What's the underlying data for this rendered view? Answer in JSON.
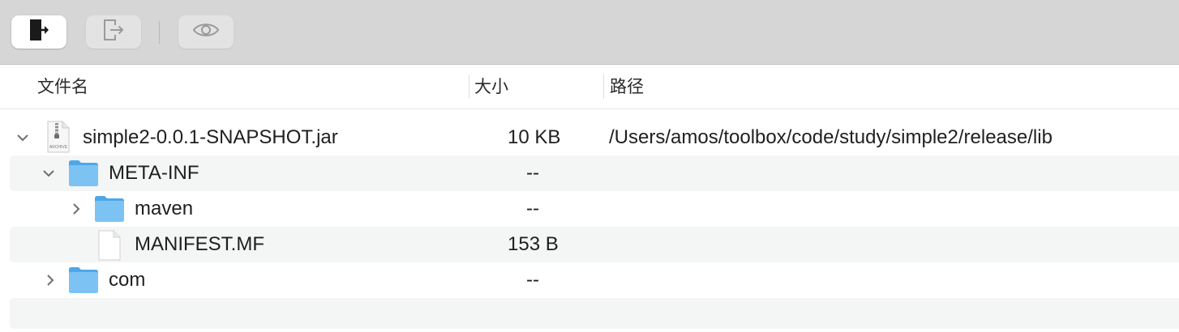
{
  "toolbar": {
    "buttons": [
      {
        "name": "export-button",
        "icon": "exit-door-icon",
        "state": "active"
      },
      {
        "name": "extract-button",
        "icon": "exit-door-outline-icon",
        "state": "disabled"
      },
      {
        "name": "preview-button",
        "icon": "eye-icon",
        "state": "disabled"
      }
    ]
  },
  "columns": {
    "name": "文件名",
    "size": "大小",
    "path": "路径"
  },
  "rows": [
    {
      "name": "simple2-0.0.1-SNAPSHOT.jar",
      "size": "10 KB",
      "path": "/Users/amos/toolbox/code/study/simple2/release/lib",
      "kind": "archive",
      "expanded": true,
      "icon_label": "ARCHIVE"
    },
    {
      "name": "META-INF",
      "size": "--",
      "path": "",
      "kind": "folder",
      "expanded": true
    },
    {
      "name": "maven",
      "size": "--",
      "path": "",
      "kind": "folder",
      "expanded": false
    },
    {
      "name": "MANIFEST.MF",
      "size": "153 B",
      "path": "",
      "kind": "file"
    },
    {
      "name": "com",
      "size": "--",
      "path": "",
      "kind": "folder",
      "expanded": false
    }
  ],
  "colors": {
    "toolbar_bg": "#d6d6d6",
    "folder_blue": "#67b7ef",
    "row_alt": "#f4f5f5"
  }
}
